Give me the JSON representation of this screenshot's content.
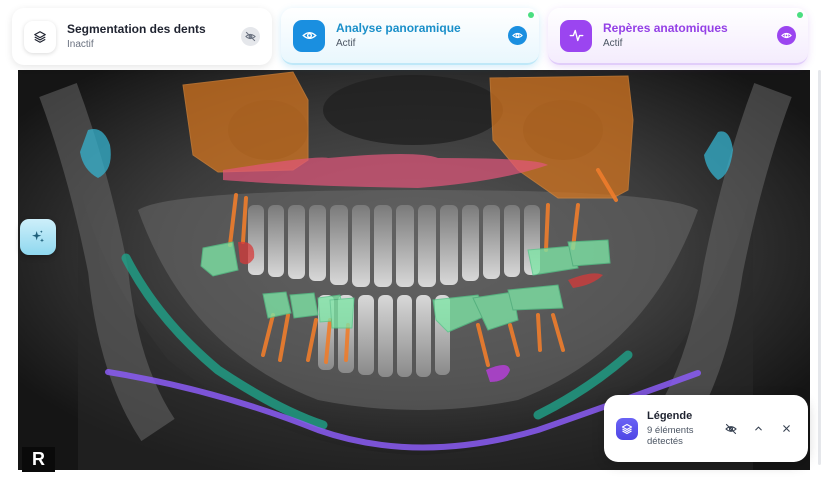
{
  "layers": [
    {
      "title": "Segmentation des dents",
      "status": "Inactif",
      "icon": "layers-icon",
      "toggle_icon": "eye-off-icon",
      "active": false
    },
    {
      "title": "Analyse panoramique",
      "status": "Actif",
      "icon": "eye-icon",
      "toggle_icon": "eye-icon",
      "active": true,
      "color": "#1a8fe0"
    },
    {
      "title": "Repères anatomiques",
      "status": "Actif",
      "icon": "activity-icon",
      "toggle_icon": "eye-icon",
      "active": true,
      "color": "#9b45f0"
    }
  ],
  "legend": {
    "title": "Légende",
    "subtitle": "9 éléments détectés",
    "icon": "layers-icon",
    "actions": [
      "eye-off-icon",
      "chevron-up-icon",
      "close-icon"
    ]
  },
  "tool_button": {
    "icon": "sparkles-icon"
  },
  "logo": {
    "letter": "R"
  },
  "overlay_colors": {
    "sinus": "#d9771f",
    "palate": "#e2557a",
    "condyle": "#35b3cf",
    "mandible_canal": "#1fa38a",
    "mandible_border": "#8b5cf6",
    "crown": "#7ee6a6",
    "root": "#ef7d2c",
    "lesion": "#d63a3a",
    "landmark": "#b43fd6"
  }
}
